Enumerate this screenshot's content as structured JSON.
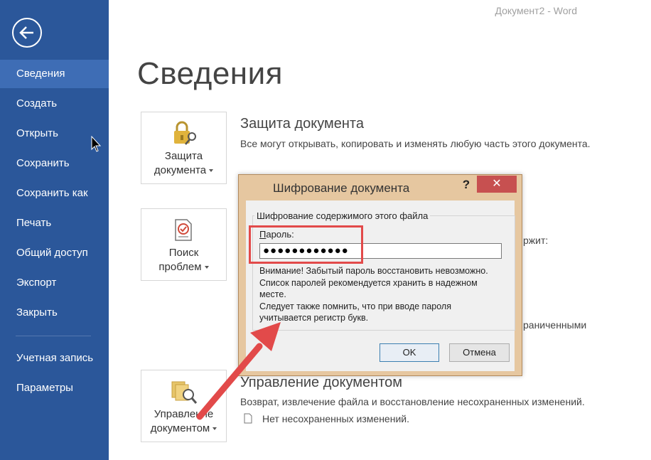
{
  "window": {
    "title": "Документ2 - Word"
  },
  "sidebar": {
    "items": [
      {
        "label": "Сведения",
        "active": true
      },
      {
        "label": "Создать"
      },
      {
        "label": "Открыть"
      },
      {
        "label": "Сохранить"
      },
      {
        "label": "Сохранить как"
      },
      {
        "label": "Печать"
      },
      {
        "label": "Общий доступ"
      },
      {
        "label": "Экспорт"
      },
      {
        "label": "Закрыть"
      },
      {
        "label": "Учетная запись"
      },
      {
        "label": "Параметры"
      }
    ],
    "accent": "#2b579a"
  },
  "main": {
    "title": "Сведения",
    "protect": {
      "tile_line1": "Защита",
      "tile_line2": "документа",
      "title": "Защита документа",
      "text": "Все могут открывать, копировать и изменять любую часть этого документа."
    },
    "inspect": {
      "tile_line1": "Поиск",
      "tile_line2": "проблем",
      "text_partial_1": "ржит:",
      "text_partial_2": "раниченными"
    },
    "manage": {
      "tile_line1": "Управление",
      "tile_line2": "документом",
      "title": "Управление документом",
      "text": "Возврат, извлечение файла и восстановление несохраненных изменений.",
      "subtext": "Нет несохраненных изменений."
    }
  },
  "dialog": {
    "title": "Шифрование документа",
    "help": "?",
    "close": "✕",
    "group_legend": "Шифрование содержимого этого файла",
    "password_label_first": "П",
    "password_label_rest": "ароль:",
    "password_value": "●●●●●●●●●●●●",
    "warning": [
      "Внимание! Забытый пароль восстановить невозможно.",
      "Список паролей рекомендуется хранить в надежном",
      "месте.",
      "Следует также помнить, что при вводе пароля",
      "учитывается регистр букв."
    ],
    "ok": "OK",
    "cancel": "Отмена"
  },
  "annotation_color": "#e24a4a"
}
